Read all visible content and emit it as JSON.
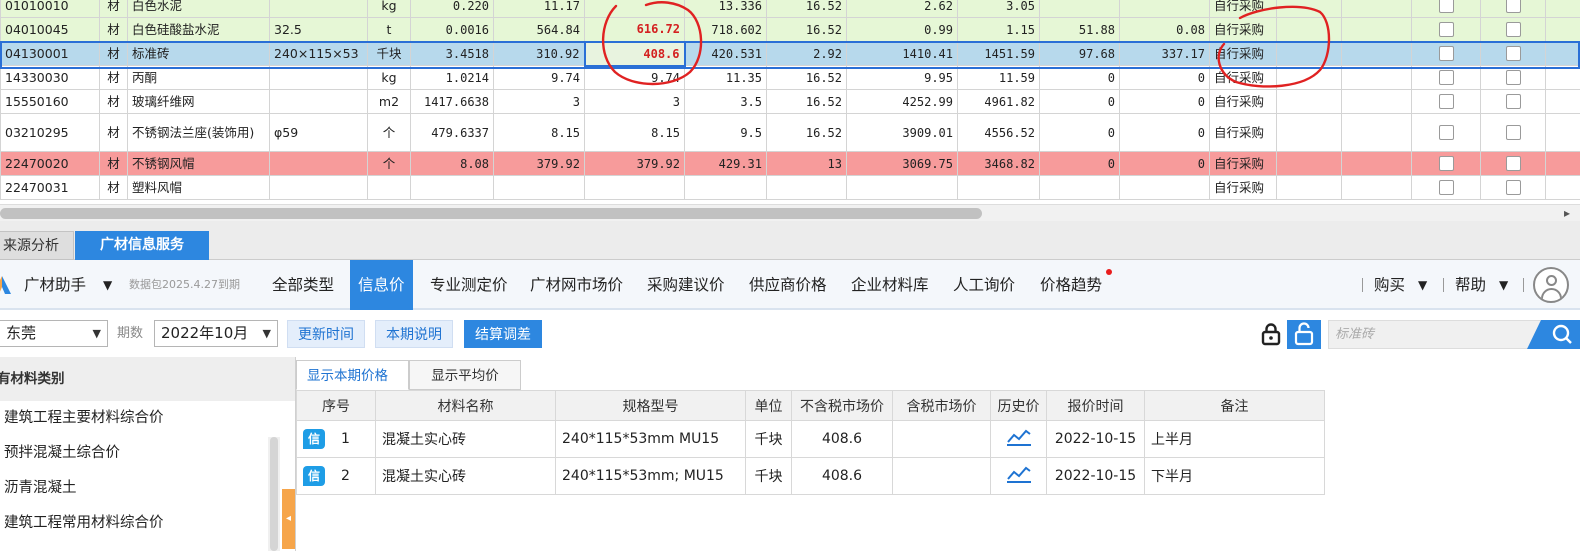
{
  "grid": {
    "rows": [
      {
        "code": "01010010",
        "kind": "材",
        "name": "白色水泥",
        "spec": "",
        "unit": "kg",
        "qty": "0.220",
        "c6": "11.17",
        "c7": "",
        "c8": "13.336",
        "c9": "16.52",
        "c10": "2.62",
        "c11": "3.05",
        "c12": "",
        "c13": "",
        "method": "自行采购",
        "style": "g"
      },
      {
        "code": "04010045",
        "kind": "材",
        "name": "白色硅酸盐水泥",
        "spec": "32.5",
        "unit": "t",
        "qty": "0.0016",
        "c6": "564.84",
        "c7": "616.72",
        "c8": "718.602",
        "c9": "16.52",
        "c10": "0.99",
        "c11": "1.15",
        "c12": "51.88",
        "c13": "0.08",
        "method": "自行采购",
        "style": "g"
      },
      {
        "code": "04130001",
        "kind": "材",
        "name": "标准砖",
        "spec": "240×115×53",
        "unit": "千块",
        "qty": "3.4518",
        "c6": "310.92",
        "c7": "408.6",
        "c8": "420.531",
        "c9": "2.92",
        "c10": "1410.41",
        "c11": "1451.59",
        "c12": "97.68",
        "c13": "337.17",
        "method": "自行采购",
        "style": "b"
      },
      {
        "code": "14330030",
        "kind": "材",
        "name": "丙酮",
        "spec": "",
        "unit": "kg",
        "qty": "1.0214",
        "c6": "9.74",
        "c7": "9.74",
        "c8": "11.35",
        "c9": "16.52",
        "c10": "9.95",
        "c11": "11.59",
        "c12": "0",
        "c13": "0",
        "method": "自行采购",
        "style": "w"
      },
      {
        "code": "15550160",
        "kind": "材",
        "name": "玻璃纤维网",
        "spec": "",
        "unit": "m2",
        "qty": "1417.6638",
        "c6": "3",
        "c7": "3",
        "c8": "3.5",
        "c9": "16.52",
        "c10": "4252.99",
        "c11": "4961.82",
        "c12": "0",
        "c13": "0",
        "method": "自行采购",
        "style": "w"
      },
      {
        "code": "03210295",
        "kind": "材",
        "name": "不锈钢法兰座(装饰用)",
        "spec": "φ59",
        "unit": "个",
        "qty": "479.6337",
        "c6": "8.15",
        "c7": "8.15",
        "c8": "9.5",
        "c9": "16.52",
        "c10": "3909.01",
        "c11": "4556.52",
        "c12": "0",
        "c13": "0",
        "method": "自行采购",
        "style": "w"
      },
      {
        "code": "22470020",
        "kind": "材",
        "name": "不锈钢风帽",
        "spec": "",
        "unit": "个",
        "qty": "8.08",
        "c6": "379.92",
        "c7": "379.92",
        "c8": "429.31",
        "c9": "13",
        "c10": "3069.75",
        "c11": "3468.82",
        "c12": "0",
        "c13": "0",
        "method": "自行采购",
        "style": "r"
      },
      {
        "code": "22470031",
        "kind": "材",
        "name": "塑料风帽",
        "spec": "",
        "unit": "",
        "qty": "",
        "c6": "",
        "c7": "",
        "c8": "",
        "c9": "",
        "c10": "",
        "c11": "",
        "c12": "",
        "c13": "",
        "method": "自行采购",
        "style": "w"
      }
    ]
  },
  "tabs": {
    "source_analysis": "来源分析",
    "material_info": "广材信息服务"
  },
  "toolbar": {
    "assistant": "广材助手",
    "package_note": "数据包2025.4.27到期",
    "nav": [
      "全部类型",
      "信息价",
      "专业测定价",
      "广材网市场价",
      "采购建议价",
      "供应商价格",
      "企业材料库",
      "人工询价",
      "价格趋势"
    ],
    "buy": "购买",
    "help": "帮助"
  },
  "filters": {
    "region": "东莞",
    "period_label": "期数",
    "period": "2022年10月",
    "update_time": "更新时间",
    "period_notes": "本期说明",
    "settle_adjust": "结算调差",
    "search_placeholder": "标准砖"
  },
  "left_panel": {
    "header": "有材料类别",
    "items": [
      "建筑工程主要材料综合价",
      "预拌混凝土综合价",
      "沥青混凝土",
      "建筑工程常用材料综合价"
    ]
  },
  "subtabs": {
    "current": "显示本期价格",
    "average": "显示平均价"
  },
  "price_table": {
    "columns": [
      "序号",
      "材料名称",
      "规格型号",
      "单位",
      "不含税市场价",
      "含税市场价",
      "历史价",
      "报价时间",
      "备注"
    ],
    "badge": "信",
    "rows": [
      {
        "no": "1",
        "name": "混凝土实心砖",
        "spec": "240*115*53mm MU15",
        "unit": "千块",
        "price_ex": "408.6",
        "price_in": "",
        "date": "2022-10-15",
        "note": "上半月"
      },
      {
        "no": "2",
        "name": "混凝土实心砖",
        "spec": "240*115*53mm; MU15",
        "unit": "千块",
        "price_ex": "408.6",
        "price_in": "",
        "date": "2022-10-15",
        "note": "下半月"
      }
    ]
  },
  "colors": {
    "accent": "#2d87e0",
    "annotation": "#e02222",
    "highlight_text": "#d42020"
  }
}
